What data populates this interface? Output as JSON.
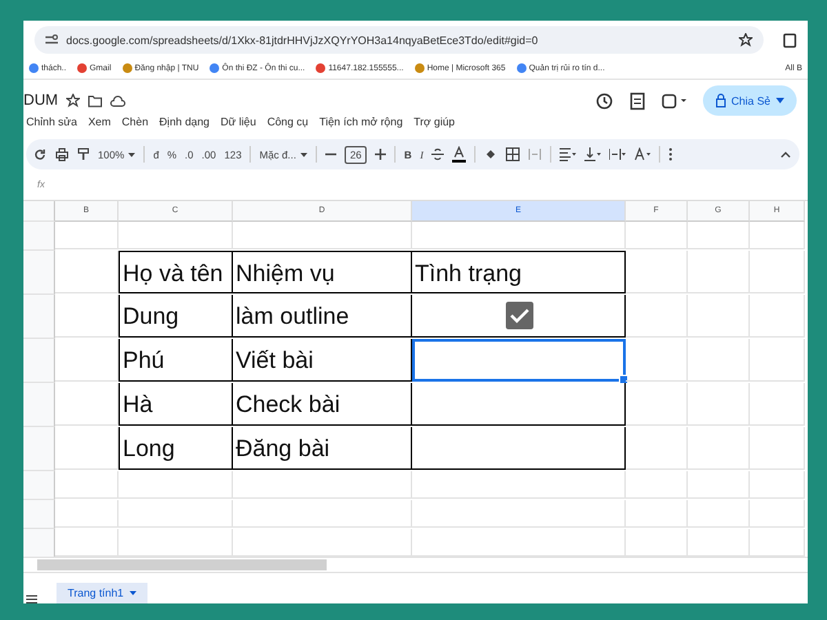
{
  "browser": {
    "url": "docs.google.com/spreadsheets/d/1Xkx-81jtdrHHVjJzXQYrYOH3a14nqyaBetEce3Tdo/edit#gid=0",
    "bookmarks": [
      "thách..",
      "Gmail",
      "Đăng nhập | TNU",
      "Ôn thi ĐZ - Ôn thi cu...",
      "11647.182.155555...",
      "Home | Microsoft 365",
      "Quản trị rủi ro tín d..."
    ],
    "bookmarks_folder": "All B"
  },
  "doc": {
    "title": "DUM",
    "share": "Chia Sẻ"
  },
  "menu": [
    "Chỉnh sửa",
    "Xem",
    "Chèn",
    "Định dạng",
    "Dữ liệu",
    "Công cụ",
    "Tiện ích mở rộng",
    "Trợ giúp"
  ],
  "toolbar": {
    "zoom": "100%",
    "currency": "đ",
    "percent": "%",
    "dec_less": ".0",
    "dec_more": ".00",
    "number": "123",
    "font": "Mặc đ...",
    "font_size": "26",
    "bold": "B",
    "italic": "I"
  },
  "formula_bar": {
    "label": "fx"
  },
  "columns": [
    {
      "label": "B",
      "selected": false
    },
    {
      "label": "C",
      "selected": false
    },
    {
      "label": "D",
      "selected": false
    },
    {
      "label": "E",
      "selected": true
    },
    {
      "label": "F",
      "selected": false
    },
    {
      "label": "G",
      "selected": false
    },
    {
      "label": "H",
      "selected": false
    }
  ],
  "table": {
    "header": [
      "Họ và tên",
      "Nhiệm vụ",
      "Tình trạng"
    ],
    "rows": [
      {
        "name": "Dung",
        "task": "làm outline",
        "checked": true,
        "selected": false
      },
      {
        "name": "Phú",
        "task": "Viết bài",
        "selected": true
      },
      {
        "name": "Hà",
        "task": "Check bài",
        "selected": false
      },
      {
        "name": "Long",
        "task": "Đăng bài",
        "selected": false
      }
    ]
  },
  "sheet_tabs": [
    {
      "label": "Trang tính1",
      "selected": true
    }
  ]
}
